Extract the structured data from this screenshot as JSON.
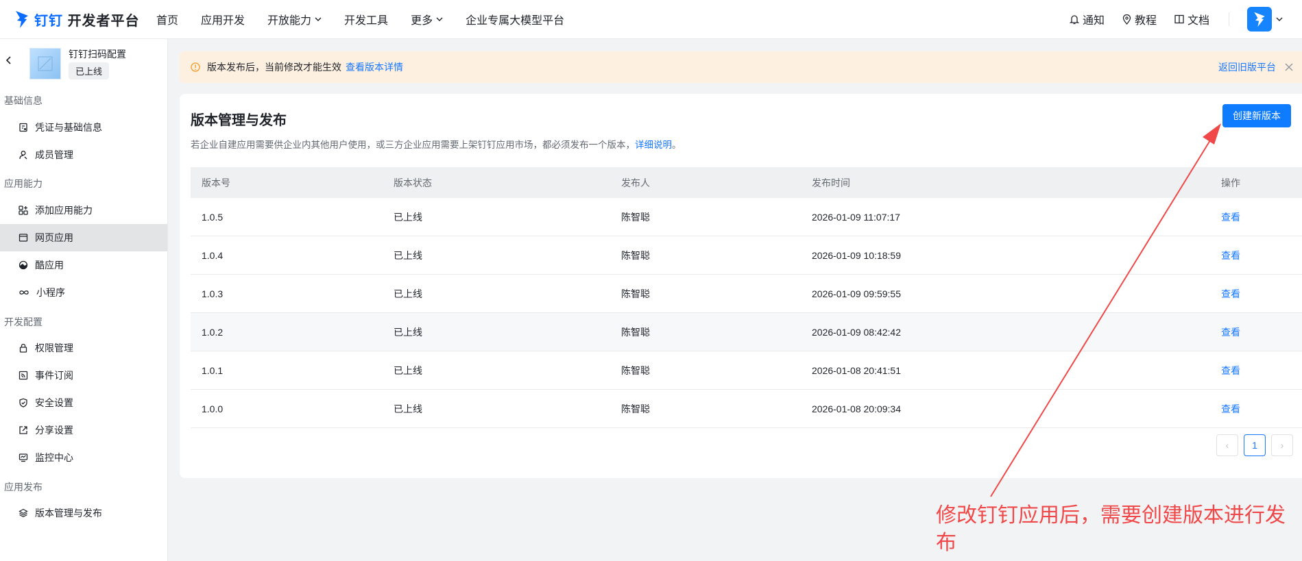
{
  "header": {
    "logo_brand": "钉钉",
    "logo_suffix": "开发者平台",
    "nav": [
      {
        "label": "首页",
        "has_dropdown": false
      },
      {
        "label": "应用开发",
        "has_dropdown": false
      },
      {
        "label": "开放能力",
        "has_dropdown": true
      },
      {
        "label": "开发工具",
        "has_dropdown": false
      },
      {
        "label": "更多",
        "has_dropdown": true
      },
      {
        "label": "企业专属大模型平台",
        "has_dropdown": false
      }
    ],
    "right_links": [
      {
        "label": "通知",
        "icon": "bell-icon"
      },
      {
        "label": "教程",
        "icon": "location-pin-icon"
      },
      {
        "label": "文档",
        "icon": "book-icon"
      }
    ],
    "accent": "#1677ff"
  },
  "sidebar": {
    "app_name": "钉钉扫码配置",
    "app_status": "已上线",
    "groups": [
      {
        "title": "基础信息",
        "items": [
          {
            "label": "凭证与基础信息",
            "icon": "credential-icon"
          },
          {
            "label": "成员管理",
            "icon": "user-icon"
          }
        ]
      },
      {
        "title": "应用能力",
        "items": [
          {
            "label": "添加应用能力",
            "icon": "add-grid-icon"
          },
          {
            "label": "网页应用",
            "icon": "browser-icon",
            "active": true
          },
          {
            "label": "酷应用",
            "icon": "cool-app-icon"
          },
          {
            "label": "小程序",
            "icon": "infinity-icon"
          }
        ]
      },
      {
        "title": "开发配置",
        "items": [
          {
            "label": "权限管理",
            "icon": "lock-icon"
          },
          {
            "label": "事件订阅",
            "icon": "rss-icon"
          },
          {
            "label": "安全设置",
            "icon": "shield-icon"
          },
          {
            "label": "分享设置",
            "icon": "share-icon"
          },
          {
            "label": "监控中心",
            "icon": "monitor-icon"
          }
        ]
      },
      {
        "title": "应用发布",
        "items": [
          {
            "label": "版本管理与发布",
            "icon": "layers-icon"
          }
        ]
      }
    ]
  },
  "notice": {
    "text": "版本发布后，当前修改才能生效",
    "link": "查看版本详情",
    "back_link": "返回旧版平台"
  },
  "main": {
    "title": "版本管理与发布",
    "desc": "若企业自建应用需要供企业内其他用户使用，或三方企业应用需要上架钉钉应用市场，都必须发布一个版本，",
    "desc_link": "详细说明",
    "desc_end": "。",
    "create_button": "创建新版本",
    "columns": [
      "版本号",
      "版本状态",
      "发布人",
      "发布时间",
      "操作"
    ],
    "rows": [
      {
        "version": "1.0.5",
        "status": "已上线",
        "publisher": "陈智聪",
        "time": "2026-01-09 11:07:17",
        "action": "查看"
      },
      {
        "version": "1.0.4",
        "status": "已上线",
        "publisher": "陈智聪",
        "time": "2026-01-09 10:18:59",
        "action": "查看"
      },
      {
        "version": "1.0.3",
        "status": "已上线",
        "publisher": "陈智聪",
        "time": "2026-01-09 09:59:55",
        "action": "查看"
      },
      {
        "version": "1.0.2",
        "status": "已上线",
        "publisher": "陈智聪",
        "time": "2026-01-09 08:42:42",
        "action": "查看"
      },
      {
        "version": "1.0.1",
        "status": "已上线",
        "publisher": "陈智聪",
        "time": "2026-01-08 20:41:51",
        "action": "查看"
      },
      {
        "version": "1.0.0",
        "status": "已上线",
        "publisher": "陈智聪",
        "time": "2026-01-08 20:09:34",
        "action": "查看"
      }
    ],
    "pagination": {
      "prev": "‹",
      "current": "1",
      "next": "›"
    }
  },
  "annotation": {
    "text": "修改钉钉应用后，需要创建版本进行发布",
    "color": "#f04848"
  }
}
